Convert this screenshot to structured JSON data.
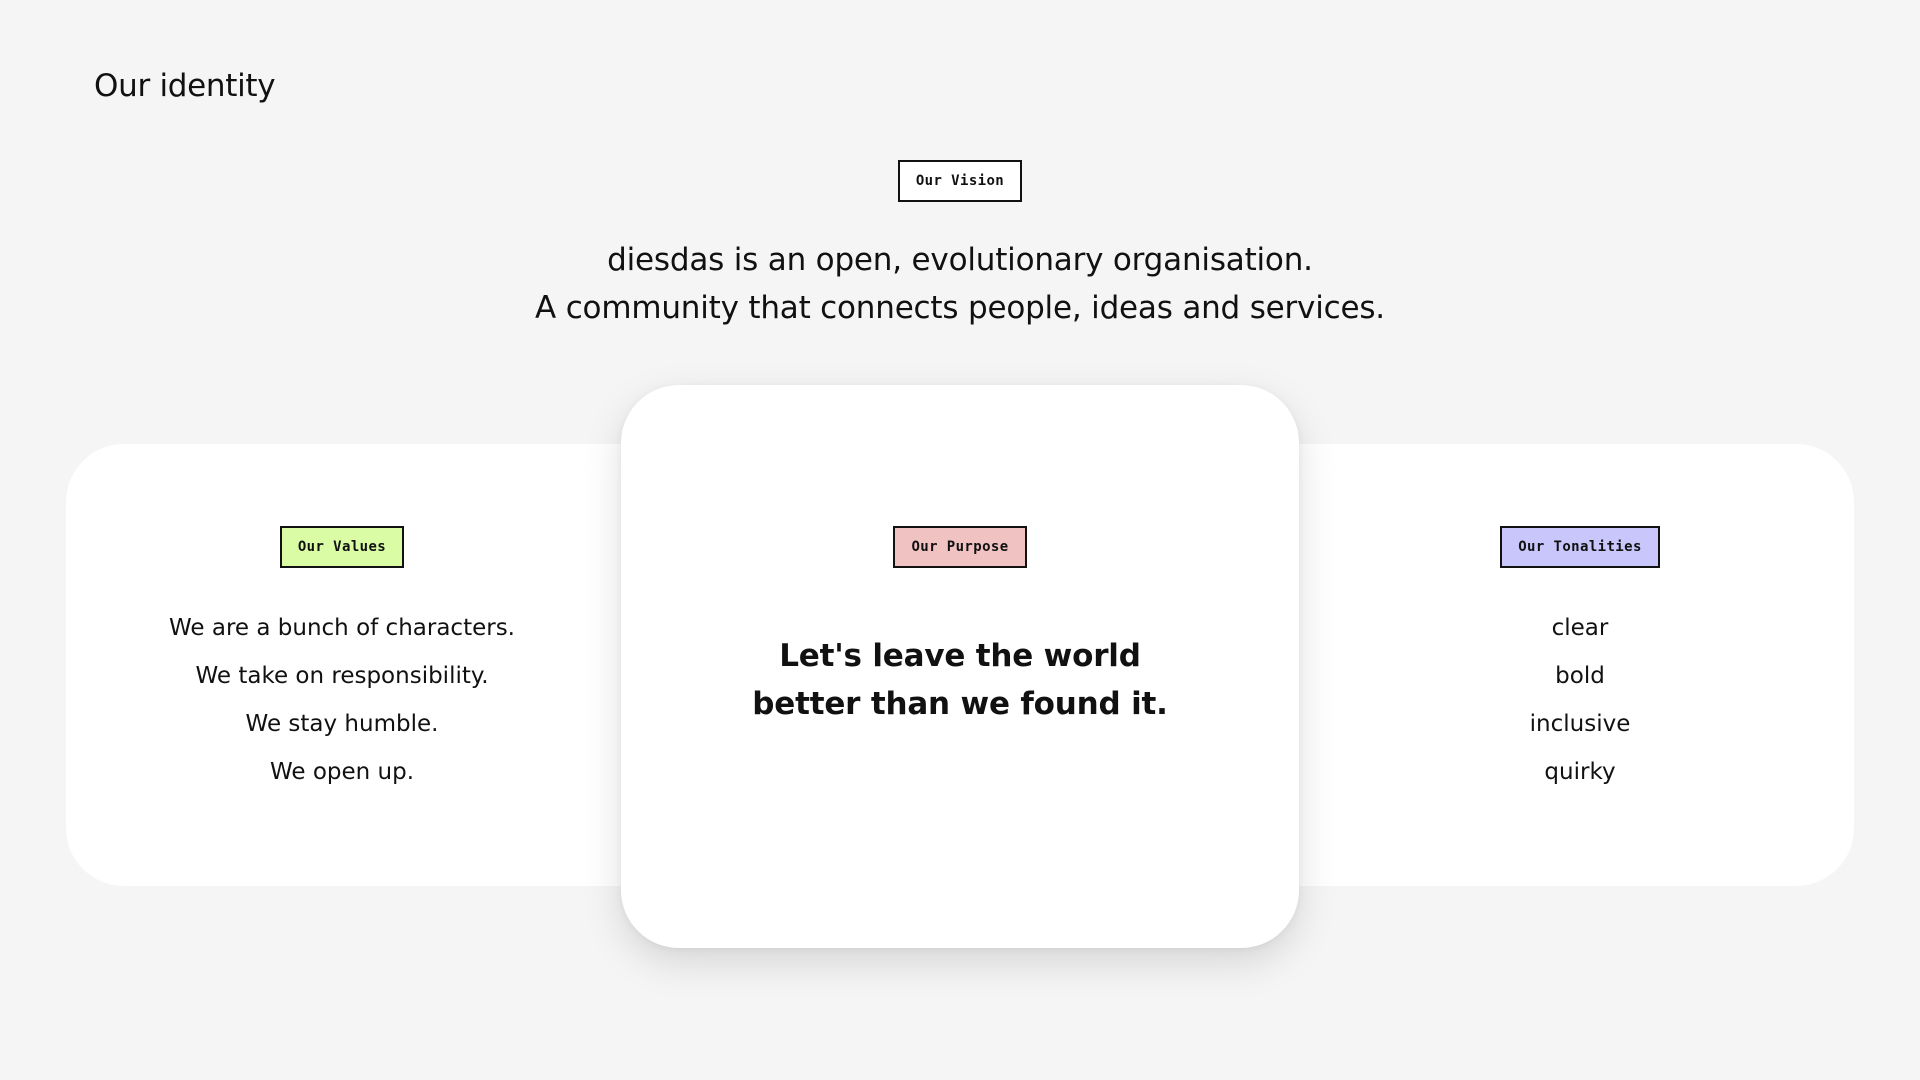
{
  "page": {
    "title": "Our identity"
  },
  "vision": {
    "tag": "Our Vision",
    "tag_color": "#ffffff",
    "lines": [
      "diesdas is an open, evolutionary organisation.",
      "A community that connects people, ideas and services."
    ]
  },
  "values": {
    "tag": "Our Values",
    "tag_color": "#d9fca5",
    "items": [
      "We are a bunch of characters.",
      "We take on responsibility.",
      "We stay humble.",
      "We open up."
    ]
  },
  "purpose": {
    "tag": "Our Purpose",
    "tag_color": "#f0c2c2",
    "lines": [
      "Let's leave the world",
      "better than we found it."
    ]
  },
  "tonalities": {
    "tag": "Our Tonalities",
    "tag_color": "#c9c6fb",
    "items": [
      "clear",
      "bold",
      "inclusive",
      "quirky"
    ]
  }
}
